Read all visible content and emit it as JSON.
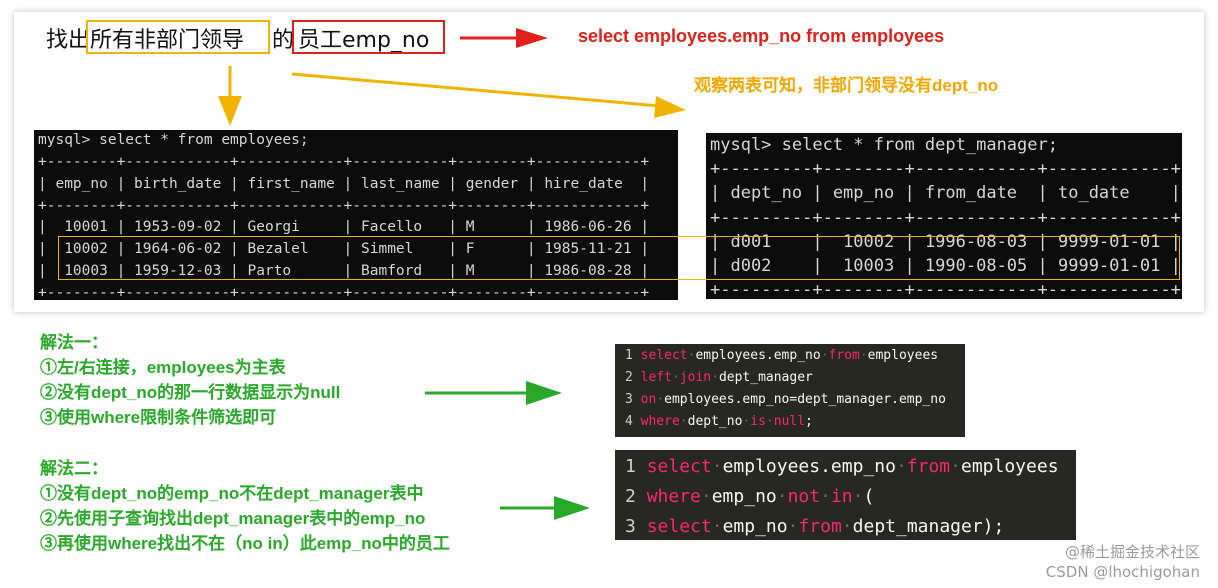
{
  "question": {
    "part1": "找出",
    "part2": "所有非部门领导",
    "part3": "的",
    "part4": "员工emp_no"
  },
  "sql_hint": "select employees.emp_no from employees",
  "observation": "观察两表可知，非部门领导没有dept_no",
  "employees_terminal": {
    "prompt": "mysql> select * from employees;",
    "sep": "+--------+------------+------------+-----------+--------+------------+",
    "header": "| emp_no | birth_date | first_name | last_name | gender | hire_date  |",
    "rows": [
      "|  10001 | 1953-09-02 | Georgi     | Facello   | M      | 1986-06-26 |",
      "|  10002 | 1964-06-02 | Bezalel    | Simmel    | F      | 1985-11-21 |",
      "|  10003 | 1959-12-03 | Parto      | Bamford   | M      | 1986-08-28 |"
    ]
  },
  "dept_terminal": {
    "prompt": "mysql> select * from dept_manager;",
    "sep": "+---------+--------+------------+------------+",
    "header": "| dept_no | emp_no | from_date  | to_date    |",
    "rows": [
      "| d001    |  10002 | 1996-08-03 | 9999-01-01 |",
      "| d002    |  10003 | 1990-08-05 | 9999-01-01 |"
    ]
  },
  "method1": {
    "title": "解法一：",
    "steps": [
      "①左/右连接，employees为主表",
      "②没有dept_no的那一行数据显示为null",
      "③使用where限制条件筛选即可"
    ]
  },
  "method2": {
    "title": "解法二：",
    "steps": [
      "①没有dept_no的emp_no不在dept_manager表中",
      "②先使用子查询找出dept_manager表中的emp_no",
      "③再使用where找出不在（no in）此emp_no中的员工"
    ]
  },
  "code1": [
    {
      "n": "1",
      "k1": "select",
      "t1": "employees.emp_no",
      "k2": "from",
      "t2": "employees"
    },
    {
      "n": "2",
      "k1": "left",
      "k2": "join",
      "t1": "dept_manager"
    },
    {
      "n": "3",
      "k1": "on",
      "t1": "employees.emp_no=dept_manager.emp_no"
    },
    {
      "n": "4",
      "k1": "where",
      "t1": "dept_no",
      "k2": "is",
      "k3": "null",
      "t2": ";"
    }
  ],
  "code2": [
    {
      "n": "1",
      "k1": "select",
      "t1": "employees.emp_no",
      "k2": "from",
      "t2": "employees"
    },
    {
      "n": "2",
      "k1": "where",
      "t1": "emp_no",
      "k2": "not",
      "k3": "in",
      "t2": "("
    },
    {
      "n": "3",
      "k1": "select",
      "t1": "emp_no",
      "k2": "from",
      "t2": "dept_manager);"
    }
  ],
  "watermark": {
    "line1": "@稀土掘金技术社区",
    "line2": "CSDN @lhochigohan"
  },
  "colors": {
    "red": "#e0201a",
    "yellow": "#f0b400",
    "green": "#2aa82a"
  }
}
